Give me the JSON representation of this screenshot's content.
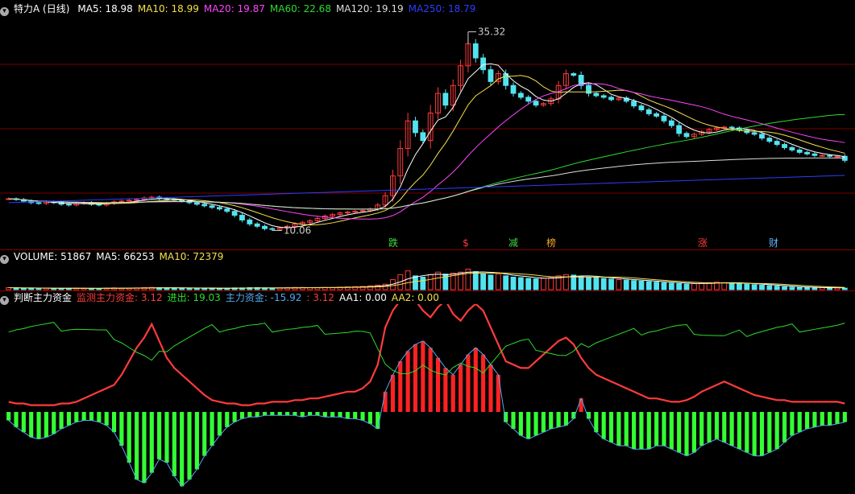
{
  "colors": {
    "up": "#ff3b3b",
    "down": "#53e3f0",
    "ma5": "#ffffff",
    "ma10": "#f5e04a",
    "ma20": "#ff44ff",
    "ma60": "#2ddc2d",
    "ma120": "#dddddd",
    "ma250": "#2d3dff",
    "grid": "#7a0000",
    "green_bar": "#33ff33",
    "red_bar": "#ff2222"
  },
  "price_panel": {
    "icon": "chevron-down-icon",
    "title": "特力A (日线)",
    "ma5": "MA5: 18.98",
    "ma10": "MA10: 18.99",
    "ma20": "MA20: 19.87",
    "ma60": "MA60: 22.68",
    "ma120": "MA120: 19.19",
    "ma250": "MA250: 18.79",
    "high_label": "35.32",
    "low_label": "10.06",
    "events": [
      {
        "text": "跌",
        "color": "#3cdc3c"
      },
      {
        "text": "$",
        "color": "#ff3b3b"
      },
      {
        "text": "减",
        "color": "#3cdc3c"
      },
      {
        "text": "榜",
        "color": "#f5a623"
      },
      {
        "text": "涨",
        "color": "#ff3b3b"
      },
      {
        "text": "财",
        "color": "#5ab4ff"
      }
    ]
  },
  "volume_panel": {
    "icon": "chevron-down-icon",
    "volume": "VOLUME: 51867",
    "ma5": "MA5: 66253",
    "ma10": "MA10: 72379"
  },
  "indicator_panel": {
    "icon": "chevron-down-icon",
    "title": "判断主力资金",
    "monitor": "监测主力资金: 3.12",
    "inout": "进出: 19.03",
    "main": "主力资金: -15.92",
    "extra": ": 3.12",
    "aa1": "AA1: 0.00",
    "aa2": "AA2: 0.00"
  },
  "chart_data": [
    {
      "type": "candlestick",
      "series_close": [
        14.1,
        14.0,
        13.8,
        13.6,
        13.5,
        13.7,
        13.6,
        13.4,
        13.3,
        13.5,
        13.6,
        13.4,
        13.3,
        13.5,
        13.7,
        13.8,
        13.9,
        14.0,
        14.2,
        14.3,
        14.1,
        14.0,
        13.9,
        13.8,
        13.6,
        13.4,
        13.2,
        13.0,
        12.8,
        12.5,
        12.0,
        11.4,
        10.9,
        10.6,
        10.3,
        10.2,
        10.4,
        10.6,
        10.9,
        11.1,
        11.3,
        11.6,
        11.9,
        12.1,
        12.3,
        12.4,
        12.5,
        12.6,
        12.8,
        13.3,
        14.5,
        17.0,
        20.5,
        24.0,
        22.5,
        21.5,
        25.0,
        27.5,
        26.0,
        28.5,
        31.0,
        33.8,
        32.0,
        30.5,
        29.0,
        30.0,
        28.5,
        27.5,
        27.0,
        26.5,
        26.0,
        26.2,
        26.8,
        28.5,
        30.0,
        29.8,
        28.5,
        27.5,
        27.2,
        27.0,
        26.7,
        26.9,
        26.5,
        25.9,
        25.4,
        24.9,
        24.6,
        24.0,
        23.4,
        22.4,
        22.0,
        22.3,
        22.6,
        22.9,
        23.1,
        23.2,
        23.1,
        22.8,
        22.5,
        22.3,
        21.8,
        21.4,
        21.0,
        20.6,
        20.3,
        20.0,
        19.8,
        19.6,
        19.6,
        19.5,
        19.5,
        18.98
      ],
      "high": 35.32,
      "low": 10.06,
      "ylim": [
        9.5,
        36.5
      ]
    },
    {
      "type": "bar",
      "name": "VOLUME",
      "values": [
        8,
        7,
        6,
        6,
        5,
        6,
        5,
        5,
        5,
        6,
        6,
        5,
        5,
        6,
        7,
        6,
        6,
        7,
        8,
        9,
        8,
        7,
        7,
        6,
        6,
        6,
        5,
        5,
        5,
        6,
        7,
        7,
        8,
        8,
        7,
        6,
        7,
        8,
        9,
        9,
        8,
        8,
        9,
        9,
        10,
        11,
        12,
        13,
        15,
        18,
        22,
        40,
        60,
        75,
        55,
        50,
        60,
        70,
        62,
        66,
        70,
        82,
        72,
        64,
        58,
        62,
        55,
        50,
        48,
        45,
        43,
        45,
        48,
        55,
        60,
        58,
        52,
        50,
        48,
        45,
        42,
        40,
        38,
        36,
        34,
        32,
        30,
        28,
        26,
        24,
        22,
        24,
        26,
        28,
        30,
        28,
        26,
        24,
        22,
        20,
        18,
        16,
        14,
        12,
        10,
        9,
        8,
        8,
        8,
        7,
        7,
        6
      ]
    },
    {
      "type": "bar",
      "name": "主力资金",
      "values": [
        -5,
        -9,
        -12,
        -15,
        -16,
        -15,
        -13,
        -10,
        -8,
        -6,
        -5,
        -5,
        -6,
        -8,
        -12,
        -20,
        -30,
        -40,
        -42,
        -36,
        -28,
        -30,
        -38,
        -44,
        -40,
        -34,
        -26,
        -20,
        -14,
        -9,
        -6,
        -4,
        -3,
        -3,
        -2,
        -2,
        -2,
        -2,
        -2,
        -3,
        -2,
        -2,
        -3,
        -3,
        -3,
        -4,
        -4,
        -5,
        -7,
        -10,
        12,
        22,
        30,
        36,
        40,
        42,
        38,
        32,
        26,
        22,
        28,
        34,
        38,
        34,
        28,
        22,
        -6,
        -10,
        -14,
        -16,
        -14,
        -12,
        -10,
        -9,
        -8,
        -4,
        8,
        -4,
        -12,
        -16,
        -18,
        -20,
        -20,
        -22,
        -22,
        -22,
        -20,
        -20,
        -22,
        -24,
        -26,
        -24,
        -20,
        -18,
        -16,
        -18,
        -20,
        -22,
        -24,
        -26,
        -26,
        -24,
        -22,
        -18,
        -14,
        -12,
        -10,
        -9,
        -8,
        -8,
        -7,
        -6
      ],
      "red_line": [
        6,
        5,
        5,
        4,
        4,
        4,
        4,
        5,
        5,
        6,
        8,
        10,
        12,
        14,
        16,
        22,
        30,
        38,
        44,
        52,
        42,
        32,
        26,
        22,
        18,
        14,
        10,
        7,
        6,
        5,
        5,
        4,
        4,
        5,
        5,
        6,
        6,
        6,
        7,
        7,
        8,
        8,
        9,
        10,
        11,
        12,
        12,
        14,
        18,
        28,
        50,
        60,
        66,
        68,
        66,
        60,
        56,
        62,
        66,
        58,
        54,
        60,
        64,
        60,
        50,
        40,
        30,
        28,
        26,
        26,
        30,
        34,
        38,
        42,
        44,
        40,
        32,
        26,
        22,
        20,
        18,
        16,
        14,
        12,
        10,
        8,
        8,
        7,
        6,
        6,
        7,
        9,
        12,
        14,
        16,
        18,
        16,
        14,
        12,
        10,
        9,
        8,
        7,
        7,
        6,
        6,
        6,
        6,
        6,
        6,
        6,
        5
      ]
    }
  ]
}
